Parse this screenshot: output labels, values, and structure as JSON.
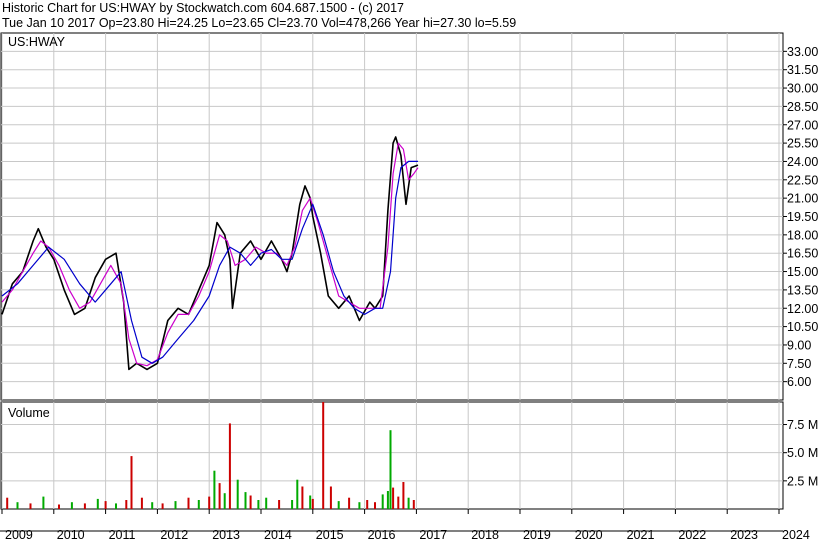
{
  "header": {
    "line1": "Historic Chart for US:HWAY by Stockwatch.com 604.687.1500 - (c) 2017",
    "line2": "Tue Jan 10 2017   Op=23.80   Hi=24.25   Lo=23.65   Cl=23.70   Vol=478,266   Year hi=27.30   lo=5.59"
  },
  "chart_data": [
    {
      "type": "line",
      "title": "US:HWAY",
      "ylim": [
        4.5,
        34.5
      ],
      "yticks": [
        6.0,
        7.5,
        9.0,
        10.5,
        12.0,
        13.5,
        15.0,
        16.5,
        18.0,
        19.5,
        21.0,
        22.5,
        24.0,
        25.5,
        27.0,
        28.5,
        30.0,
        31.5,
        33.0
      ],
      "ytick_labels": [
        "6.00",
        "7.50",
        "9.00",
        "10.50",
        "12.00",
        "13.50",
        "15.00",
        "16.50",
        "18.00",
        "19.50",
        "21.00",
        "22.50",
        "24.00",
        "25.50",
        "27.00",
        "28.50",
        "30.00",
        "31.50",
        "33.00"
      ],
      "x_labels": [
        "2009",
        "2010",
        "2011",
        "2012",
        "2013",
        "2014",
        "2015",
        "2016",
        "2017",
        "2018",
        "2019",
        "2020",
        "2021",
        "2022",
        "2023",
        "2024"
      ],
      "xlim": [
        2009.0,
        2024.4
      ],
      "grid": true,
      "series": [
        {
          "color": "#000000",
          "x": [
            2009.0,
            2009.2,
            2009.4,
            2009.6,
            2009.7,
            2009.85,
            2010.0,
            2010.2,
            2010.4,
            2010.6,
            2010.8,
            2011.0,
            2011.2,
            2011.35,
            2011.45,
            2011.6,
            2011.8,
            2012.0,
            2012.2,
            2012.4,
            2012.6,
            2012.8,
            2013.0,
            2013.15,
            2013.3,
            2013.4,
            2013.45,
            2013.6,
            2013.8,
            2014.0,
            2014.2,
            2014.4,
            2014.5,
            2014.6,
            2014.75,
            2014.85,
            2014.95,
            2015.0,
            2015.15,
            2015.3,
            2015.5,
            2015.7,
            2015.9,
            2016.1,
            2016.2,
            2016.35,
            2016.45,
            2016.55,
            2016.6,
            2016.7,
            2016.8,
            2016.9,
            2017.03
          ],
          "y": [
            11.5,
            14.0,
            15.0,
            17.5,
            18.5,
            17.0,
            16.0,
            13.5,
            11.5,
            12.0,
            14.5,
            16.0,
            16.5,
            12.5,
            7.0,
            7.5,
            7.0,
            7.5,
            11.0,
            12.0,
            11.5,
            13.5,
            15.5,
            19.0,
            18.0,
            16.0,
            12.0,
            16.5,
            17.5,
            16.0,
            17.5,
            16.0,
            15.0,
            16.5,
            20.5,
            22.0,
            21.0,
            19.5,
            16.5,
            13.0,
            12.0,
            13.0,
            11.0,
            12.5,
            12.0,
            13.0,
            20.0,
            25.5,
            26.0,
            24.5,
            20.5,
            23.5,
            23.7
          ]
        },
        {
          "color": "#cc00cc",
          "x": [
            2009.0,
            2009.2,
            2009.4,
            2009.6,
            2009.75,
            2009.9,
            2010.1,
            2010.3,
            2010.5,
            2010.7,
            2010.9,
            2011.1,
            2011.3,
            2011.45,
            2011.6,
            2011.8,
            2012.0,
            2012.2,
            2012.4,
            2012.6,
            2012.8,
            2013.0,
            2013.2,
            2013.35,
            2013.5,
            2013.7,
            2013.9,
            2014.1,
            2014.3,
            2014.5,
            2014.65,
            2014.8,
            2014.95,
            2015.1,
            2015.3,
            2015.5,
            2015.7,
            2015.9,
            2016.1,
            2016.3,
            2016.45,
            2016.55,
            2016.65,
            2016.75,
            2016.85,
            2016.95,
            2017.03
          ],
          "y": [
            12.5,
            13.5,
            15.0,
            16.5,
            17.5,
            17.0,
            15.5,
            13.5,
            12.0,
            12.5,
            14.0,
            15.5,
            14.0,
            9.5,
            7.5,
            7.3,
            7.8,
            10.0,
            11.5,
            11.5,
            13.0,
            15.0,
            18.0,
            17.5,
            15.5,
            16.0,
            17.0,
            16.5,
            16.5,
            15.5,
            17.0,
            20.0,
            21.0,
            19.0,
            16.0,
            13.0,
            12.5,
            12.0,
            12.0,
            12.0,
            17.0,
            23.0,
            25.5,
            25.0,
            22.5,
            23.0,
            23.5
          ]
        },
        {
          "color": "#0000cc",
          "x": [
            2009.0,
            2009.3,
            2009.6,
            2009.9,
            2010.2,
            2010.5,
            2010.8,
            2011.1,
            2011.3,
            2011.5,
            2011.7,
            2011.9,
            2012.1,
            2012.4,
            2012.7,
            2013.0,
            2013.2,
            2013.4,
            2013.6,
            2013.8,
            2014.0,
            2014.2,
            2014.4,
            2014.6,
            2014.8,
            2015.0,
            2015.2,
            2015.4,
            2015.6,
            2015.8,
            2016.0,
            2016.2,
            2016.35,
            2016.5,
            2016.6,
            2016.7,
            2016.85,
            2016.95,
            2017.03
          ],
          "y": [
            13.0,
            14.0,
            15.5,
            17.0,
            16.0,
            14.0,
            12.5,
            14.0,
            15.0,
            11.0,
            8.0,
            7.5,
            8.0,
            9.5,
            11.0,
            13.0,
            15.5,
            17.0,
            16.5,
            15.5,
            16.5,
            16.8,
            16.0,
            16.0,
            18.5,
            20.5,
            18.0,
            15.0,
            13.0,
            12.0,
            11.5,
            12.0,
            12.0,
            15.0,
            21.0,
            23.5,
            24.0,
            24.0,
            24.0
          ]
        }
      ]
    },
    {
      "type": "bar",
      "title": "Volume",
      "ylim": [
        0,
        9.5
      ],
      "yticks": [
        2.5,
        5.0,
        7.5
      ],
      "ytick_labels": [
        "2.5 M",
        "5.0 M",
        "7.5 M"
      ],
      "grid": true,
      "x": [
        2009.1,
        2009.3,
        2009.55,
        2009.8,
        2010.1,
        2010.35,
        2010.6,
        2010.85,
        2011.0,
        2011.2,
        2011.4,
        2011.5,
        2011.7,
        2011.9,
        2012.1,
        2012.35,
        2012.6,
        2012.8,
        2013.0,
        2013.1,
        2013.2,
        2013.3,
        2013.4,
        2013.55,
        2013.7,
        2013.8,
        2013.95,
        2014.1,
        2014.35,
        2014.6,
        2014.7,
        2014.8,
        2014.95,
        2015.0,
        2015.2,
        2015.35,
        2015.5,
        2015.7,
        2015.9,
        2016.05,
        2016.2,
        2016.35,
        2016.45,
        2016.5,
        2016.55,
        2016.65,
        2016.75,
        2016.85,
        2016.95
      ],
      "values": [
        1.0,
        0.6,
        0.5,
        1.1,
        0.4,
        0.6,
        0.5,
        0.9,
        0.7,
        0.5,
        0.8,
        4.7,
        1.0,
        0.6,
        0.5,
        0.7,
        1.0,
        0.8,
        1.1,
        3.4,
        2.3,
        1.4,
        7.6,
        2.6,
        1.5,
        1.2,
        0.8,
        1.0,
        0.8,
        0.8,
        2.6,
        2.0,
        1.2,
        0.9,
        9.5,
        2.0,
        0.7,
        1.0,
        0.6,
        0.8,
        0.6,
        1.3,
        1.6,
        7.0,
        1.9,
        1.1,
        2.4,
        1.0,
        0.8
      ],
      "colors": [
        "#cc0000",
        "#00aa00",
        "#cc0000",
        "#00aa00",
        "#cc0000",
        "#00aa00",
        "#cc0000",
        "#00aa00",
        "#cc0000",
        "#00aa00",
        "#cc0000",
        "#cc0000",
        "#cc0000",
        "#00aa00",
        "#cc0000",
        "#00aa00",
        "#cc0000",
        "#00aa00",
        "#cc0000",
        "#00aa00",
        "#cc0000",
        "#00aa00",
        "#cc0000",
        "#00aa00",
        "#00aa00",
        "#cc0000",
        "#00aa00",
        "#00aa00",
        "#cc0000",
        "#00aa00",
        "#00aa00",
        "#cc0000",
        "#00aa00",
        "#cc0000",
        "#cc0000",
        "#cc0000",
        "#00aa00",
        "#cc0000",
        "#00aa00",
        "#cc0000",
        "#cc0000",
        "#00aa00",
        "#00aa00",
        "#00aa00",
        "#cc0000",
        "#cc0000",
        "#cc0000",
        "#00aa00",
        "#cc0000"
      ]
    }
  ]
}
